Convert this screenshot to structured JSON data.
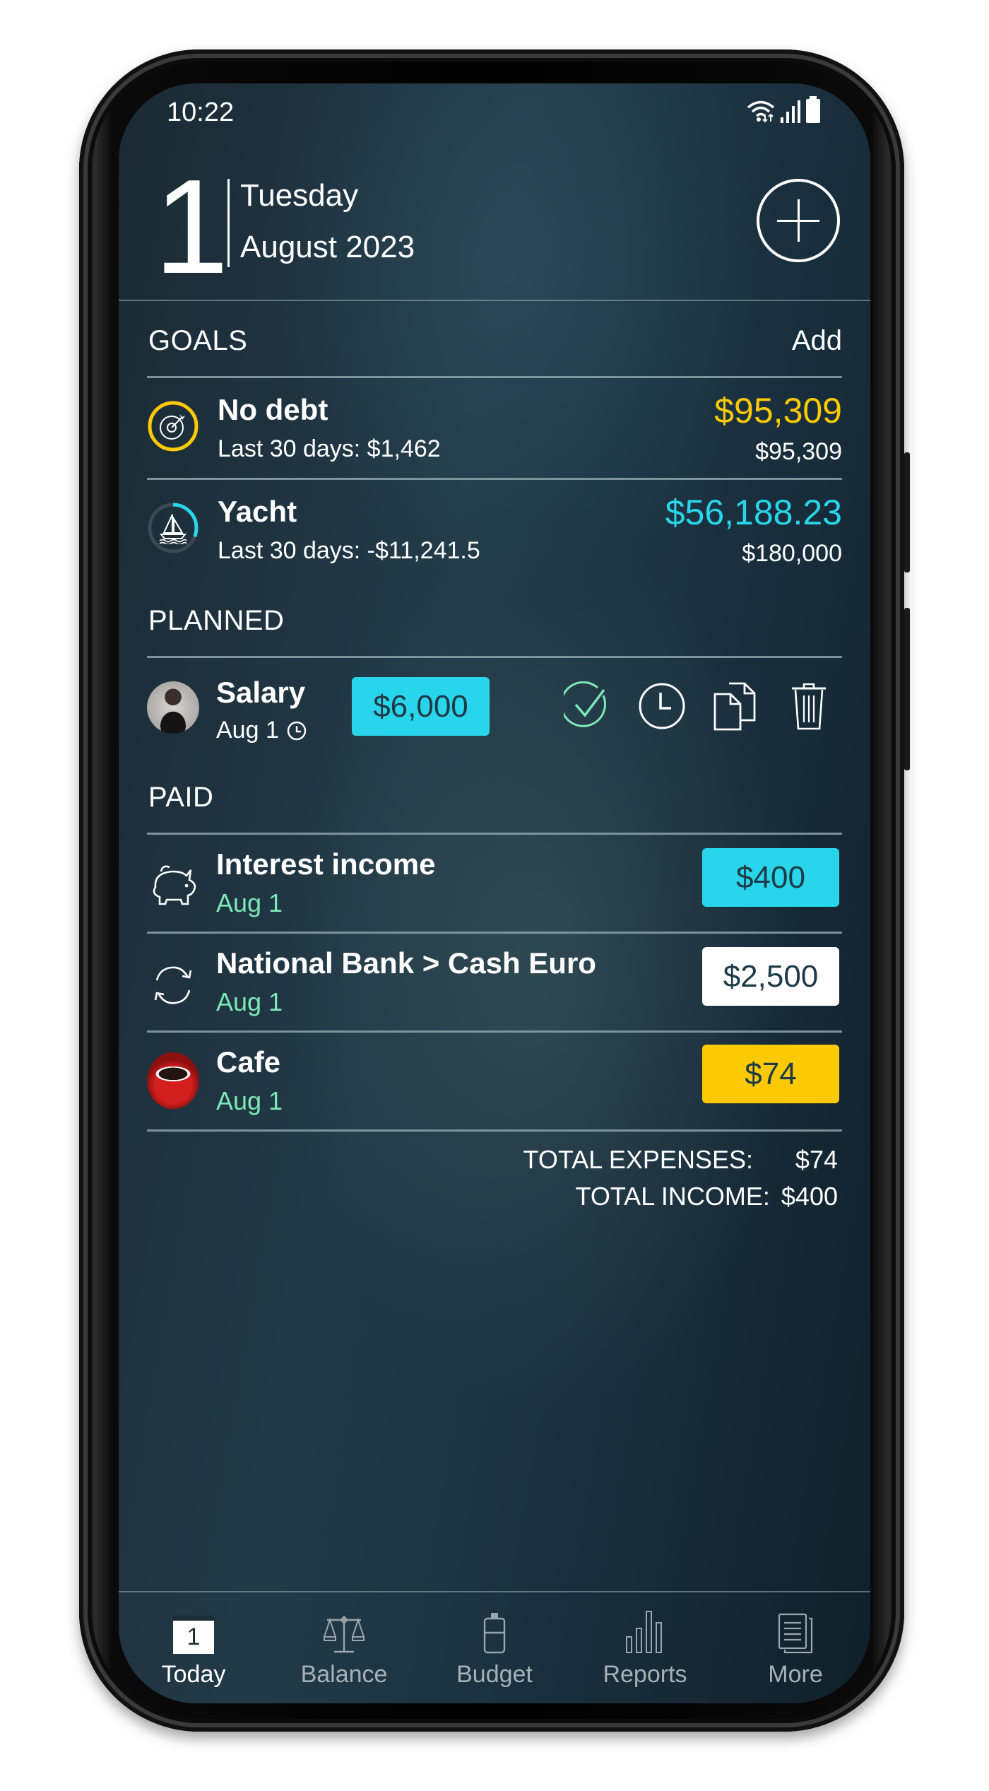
{
  "status_bar": {
    "time": "10:22",
    "icons": [
      "wifi-icon",
      "signal-icon",
      "battery-icon"
    ]
  },
  "header": {
    "day": "1",
    "weekday": "Tuesday",
    "month_year": "August 2023",
    "add_button": "add-icon"
  },
  "goals": {
    "title": "GOALS",
    "action_label": "Add",
    "items": [
      {
        "name": "No debt",
        "subtitle": "Last 30 days: $1,462",
        "current": "$95,309",
        "target": "$95,309",
        "icon": "target-icon",
        "progress": 1.0,
        "accent": "#fcc905"
      },
      {
        "name": "Yacht",
        "subtitle": "Last 30 days: -$11,241.5",
        "current": "$56,188.23",
        "target": "$180,000",
        "icon": "sailboat-icon",
        "progress": 0.31,
        "accent": "#29d5ea"
      }
    ]
  },
  "planned": {
    "title": "PLANNED",
    "items": [
      {
        "name": "Salary",
        "date": "Aug 1",
        "amount": "$6,000",
        "chip_color": "#29d5ea",
        "icon": "avatar-photo",
        "actions": [
          "confirm-icon",
          "reschedule-clock-icon",
          "duplicate-icon",
          "delete-trash-icon"
        ]
      }
    ]
  },
  "paid": {
    "title": "PAID",
    "items": [
      {
        "name": "Interest income",
        "date": "Aug 1",
        "amount": "$400",
        "chip_color": "#29d5ea",
        "icon": "piggy-bank-icon"
      },
      {
        "name": "National Bank > Cash Euro",
        "date": "Aug 1",
        "amount": "$2,500",
        "chip_color": "#ffffff",
        "icon": "transfer-icon"
      },
      {
        "name": "Cafe",
        "date": "Aug 1",
        "amount": "$74",
        "chip_color": "#fcc905",
        "icon": "coffee-cup-icon"
      }
    ]
  },
  "totals": {
    "expenses_label": "TOTAL EXPENSES:",
    "expenses_value": "$74",
    "income_label": "TOTAL INCOME:",
    "income_value": "$400"
  },
  "nav": {
    "active": "Today",
    "items": [
      {
        "label": "Today",
        "icon": "calendar-icon",
        "icon_text": "1"
      },
      {
        "label": "Balance",
        "icon": "scales-icon"
      },
      {
        "label": "Budget",
        "icon": "budget-jar-icon"
      },
      {
        "label": "Reports",
        "icon": "bar-chart-icon"
      },
      {
        "label": "More",
        "icon": "documents-icon"
      }
    ]
  },
  "colors": {
    "accent_cyan": "#29d5ea",
    "accent_yellow": "#fcc905",
    "date_green": "#7de8b8",
    "chip_text": "#1e3a47"
  }
}
